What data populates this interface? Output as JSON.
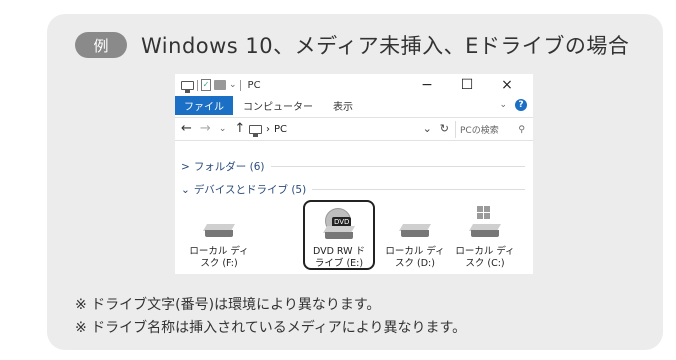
{
  "heading": {
    "badge": "例",
    "text": "Windows 10、メディア未挿入、Eドライブの場合"
  },
  "explorer": {
    "title": "PC",
    "window_buttons": {
      "minimize": "−",
      "maximize": "☐",
      "close": "×"
    },
    "ribbon_tabs": [
      "ファイル",
      "コンピューター",
      "表示"
    ],
    "nav": {
      "back": "←",
      "forward": "→",
      "recent": "⌄",
      "up": "↑"
    },
    "address": "PC",
    "address_separator": "›",
    "dropdown": "⌄",
    "refresh": "↻",
    "search_placeholder": "PCの検索",
    "search_icon": "⚲",
    "ribbon_chevron": "⌄",
    "help": "?",
    "groups": [
      {
        "chevron": ">",
        "label": "フォルダー (6)"
      },
      {
        "chevron": "⌄",
        "label": "デバイスとドライブ (5)"
      }
    ],
    "drives": [
      {
        "label": "ローカル ディ\nスク (F:)",
        "type": "hdd"
      },
      {
        "label": "DVD RW ド\nライブ (E:)",
        "type": "dvd",
        "tag": "DVD"
      },
      {
        "label": "ローカル ディ\nスク (D:)",
        "type": "hdd"
      },
      {
        "label": "ローカル ディ\nスク (C:)",
        "type": "system"
      }
    ]
  },
  "notes": [
    "※ ドライブ文字(番号)は環境により異なります。",
    "※ ドライブ名称は挿入されているメディアにより異なります。"
  ]
}
